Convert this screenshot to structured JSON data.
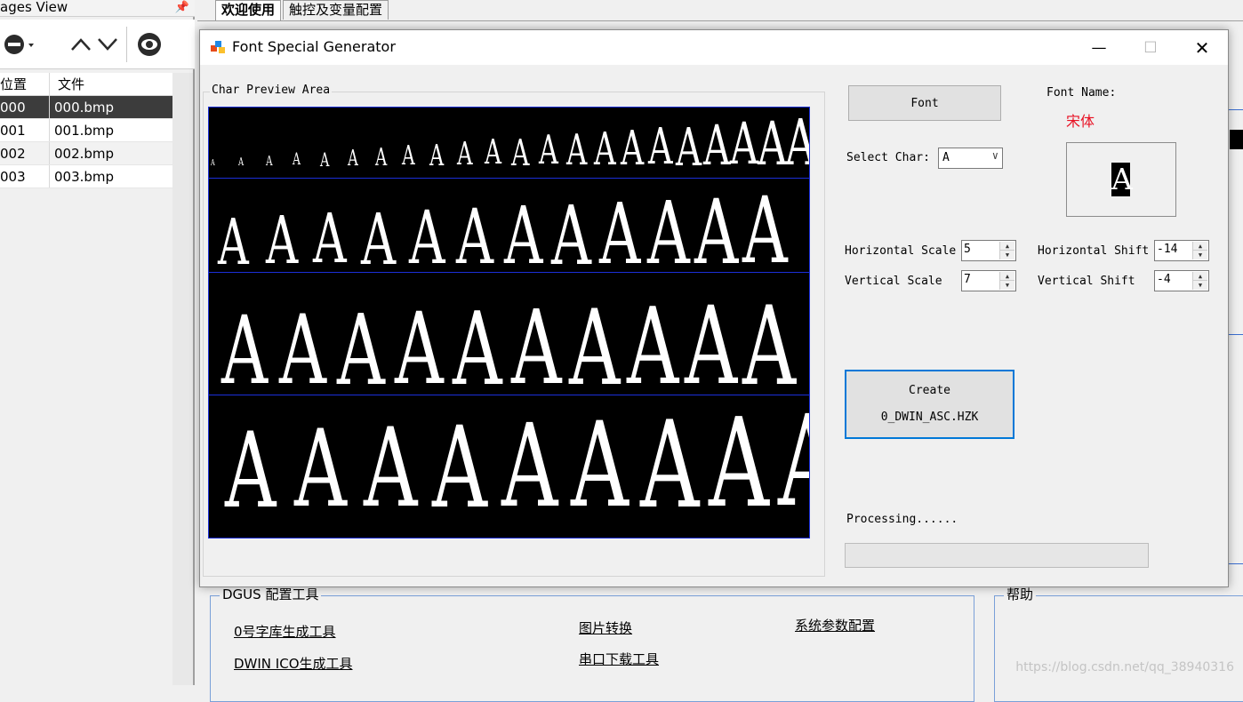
{
  "left_pane": {
    "title": "ages View",
    "header_pos": "位置",
    "header_file": "文件",
    "rows": [
      {
        "pos": "000",
        "file": "000.bmp"
      },
      {
        "pos": "001",
        "file": "001.bmp"
      },
      {
        "pos": "002",
        "file": "002.bmp"
      },
      {
        "pos": "003",
        "file": "003.bmp"
      }
    ]
  },
  "tabs": [
    {
      "label": "欢迎使用"
    },
    {
      "label": "触控及变量配置"
    }
  ],
  "dialog": {
    "title": "Font Special Generator",
    "preview_label": "Char Preview Area",
    "preview_char": "A",
    "font_button": "Font",
    "font_name_label": "Font Name:",
    "font_name_value": "宋体",
    "select_char_label": "Select Char:",
    "select_char_value": "A",
    "h_scale_label": "Horizontal Scale",
    "h_scale_value": "5",
    "v_scale_label": "Vertical Scale",
    "v_scale_value": "7",
    "h_shift_label": "Horizontal Shift",
    "h_shift_value": "-14",
    "v_shift_label": "Vertical Shift",
    "v_shift_value": "-4",
    "create_label_1": "Create",
    "create_label_2": "0_DWIN_ASC.HZK",
    "processing_label": "Processing......"
  },
  "bottom": {
    "group_tools_title": "DGUS 配置工具",
    "group_help_title": "帮助",
    "links": {
      "font_tool": "0号字库生成工具",
      "ico_tool": "DWIN ICO生成工具",
      "image_convert": "图片转换",
      "serial_download": "串口下载工具",
      "system_config": "系统参数配置"
    },
    "watermark": "https://blog.csdn.net/qq_38940316"
  },
  "colors": {
    "accent": "#0078d7",
    "font_name_color": "#e81123",
    "preview_bg": "#000000",
    "preview_grid": "#1b2fd9"
  }
}
